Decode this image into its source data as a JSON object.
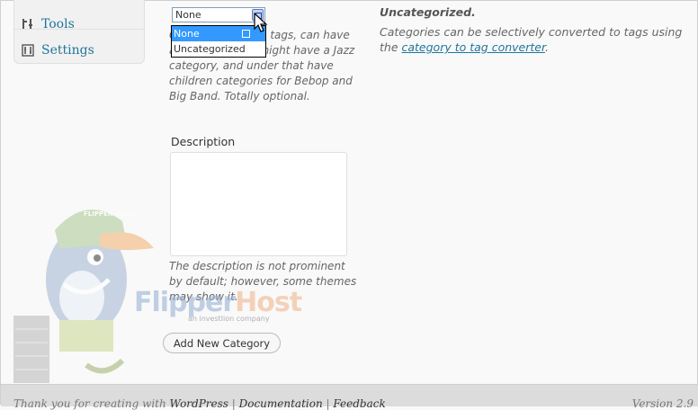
{
  "sidebar": {
    "items": [
      {
        "label": "Tools",
        "icon": "tools-icon"
      },
      {
        "label": "Settings",
        "icon": "settings-icon"
      }
    ]
  },
  "parent_field": {
    "selected": "None",
    "options": [
      "None",
      "Uncategorized"
    ],
    "help": "Categories, unlike tags, can have a hierarchy. You might have a Jazz category, and under that have children categories for Bebop and Big Band. Totally optional."
  },
  "description": {
    "label": "Description",
    "value": "",
    "help": "The description is not prominent by default; however, some themes may show it."
  },
  "add_button": "Add New Category",
  "right_help": {
    "default_category": "Uncategorized",
    "text_before": "Categories can be selectively converted to tags using the ",
    "link": "category to tag converter",
    "text_after": "."
  },
  "footer": {
    "thanks": "Thank you for creating with ",
    "wordpress": "WordPress",
    "sep1": " | ",
    "documentation": "Documentation",
    "sep2": " | ",
    "feedback": "Feedback",
    "version": "Version 2.9"
  },
  "watermark": {
    "brand_a": "Flipper",
    "brand_b": "Host",
    "tagline": "an investlion company",
    "cap": "FLIPPER HOST"
  }
}
